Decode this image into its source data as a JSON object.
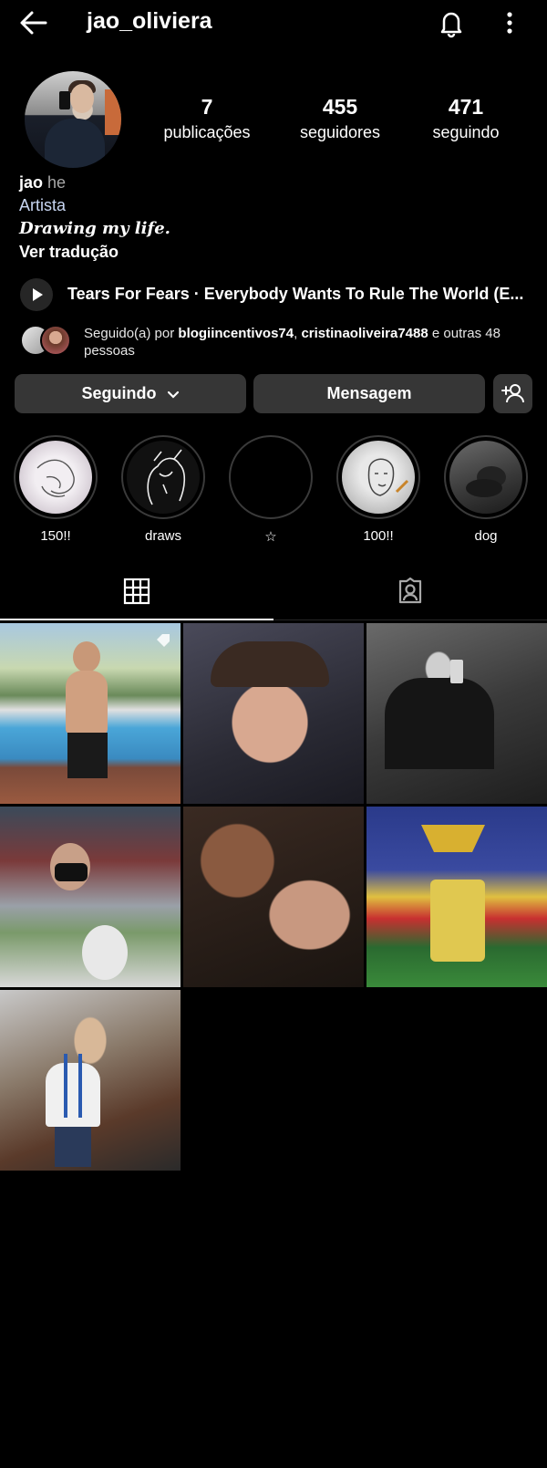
{
  "header": {
    "username": "jao_oliviera"
  },
  "stats": [
    {
      "value": "7",
      "label": "publicações"
    },
    {
      "value": "455",
      "label": "seguidores"
    },
    {
      "value": "471",
      "label": "seguindo"
    }
  ],
  "bio": {
    "name": "jao",
    "pronouns": "he",
    "category": "Artista",
    "text": "Drawing my life.",
    "translate": "Ver tradução"
  },
  "music": {
    "title": "Tears For Fears · Everybody Wants To Rule The World (E..."
  },
  "followed_by": {
    "prefix": "Seguido(a) por ",
    "user1": "blogiincentivos74",
    "sep": ", ",
    "user2": "cristinaoliveira7488",
    "suffix": " e outras 48 pessoas"
  },
  "buttons": {
    "following": "Seguindo",
    "message": "Mensagem"
  },
  "highlights": [
    {
      "label": "150!!"
    },
    {
      "label": "draws"
    },
    {
      "label": "☆"
    },
    {
      "label": "100!!"
    },
    {
      "label": "dog"
    }
  ]
}
